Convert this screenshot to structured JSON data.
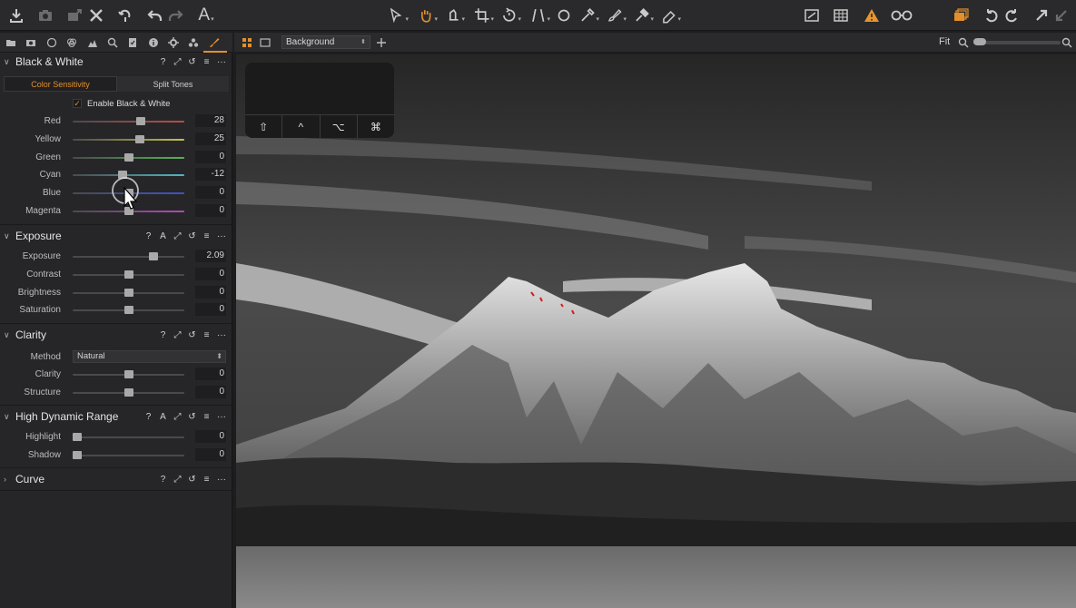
{
  "toolbar": {
    "left_icons": [
      "import-icon",
      "camera-icon",
      "export-icon",
      "delete-icon",
      "undo-history-icon",
      "undo-icon",
      "redo-icon",
      "text-icon"
    ],
    "center_tools": [
      "select-tool-icon",
      "pan-tool-icon",
      "loupe-tool-icon",
      "crop-tool-icon",
      "rotate-tool-icon",
      "keystone-tool-icon",
      "spot-tool-icon",
      "picker-tool-icon",
      "brush-tool-icon",
      "gradient-tool-icon",
      "eraser-tool-icon"
    ],
    "right_icons": [
      "overlay-icon",
      "grid-icon",
      "warning-icon",
      "proof-glasses-icon",
      "stack-icon",
      "rotate-left-icon",
      "rotate-right-icon",
      "expand-icon",
      "collapse-icon"
    ],
    "warning_color": "#e8962e"
  },
  "tool_tabs": {
    "icons": [
      "library-icon",
      "capture-icon",
      "lens-icon",
      "color-icon",
      "exposure-icon",
      "details-icon",
      "adjustments-icon",
      "metadata-icon",
      "output-icon",
      "batch-icon",
      "local-adjust-icon"
    ],
    "active": "local-adjust-icon",
    "accent": "#e28f2c"
  },
  "sections": {
    "bw": {
      "title": "Black & White",
      "actions": [
        "?",
        "⤢",
        "↺",
        "≡",
        "···"
      ],
      "tabs": [
        "Color Sensitivity",
        "Split Tones"
      ],
      "active_tab": "Color Sensitivity",
      "enable_label": "Enable Black & White",
      "enable_checked": true,
      "sliders": [
        {
          "label": "Red",
          "value": "28",
          "fraction": 0.62,
          "color": "#c04a4a"
        },
        {
          "label": "Yellow",
          "value": "25",
          "fraction": 0.61,
          "color": "#c7c14a"
        },
        {
          "label": "Green",
          "value": "0",
          "fraction": 0.5,
          "color": "#56b356"
        },
        {
          "label": "Cyan",
          "value": "-12",
          "fraction": 0.44,
          "color": "#52b6c3"
        },
        {
          "label": "Blue",
          "value": "0",
          "fraction": 0.5,
          "color": "#3f52c6"
        },
        {
          "label": "Magenta",
          "value": "0",
          "fraction": 0.5,
          "color": "#b04ab8"
        }
      ]
    },
    "exposure": {
      "title": "Exposure",
      "actions": [
        "?",
        "A",
        "⤢",
        "↺",
        "≡",
        "···"
      ],
      "sliders": [
        {
          "label": "Exposure",
          "value": "2.09",
          "fraction": 0.74
        },
        {
          "label": "Contrast",
          "value": "0",
          "fraction": 0.5
        },
        {
          "label": "Brightness",
          "value": "0",
          "fraction": 0.5
        },
        {
          "label": "Saturation",
          "value": "0",
          "fraction": 0.5
        }
      ]
    },
    "clarity": {
      "title": "Clarity",
      "actions": [
        "?",
        "⤢",
        "↺",
        "≡",
        "···"
      ],
      "method_label": "Method",
      "method_value": "Natural",
      "sliders": [
        {
          "label": "Clarity",
          "value": "0",
          "fraction": 0.5
        },
        {
          "label": "Structure",
          "value": "0",
          "fraction": 0.5
        }
      ]
    },
    "hdr": {
      "title": "High Dynamic Range",
      "actions": [
        "?",
        "A",
        "⤢",
        "↺",
        "≡",
        "···"
      ],
      "sliders": [
        {
          "label": "Highlight",
          "value": "0",
          "fraction": 0.0
        },
        {
          "label": "Shadow",
          "value": "0",
          "fraction": 0.0
        }
      ]
    },
    "curve": {
      "title": "Curve",
      "actions": [
        "?",
        "⤢",
        "↺",
        "≡",
        "···"
      ]
    }
  },
  "viewer": {
    "layer_select": "Background",
    "zoom_label": "Fit",
    "keypad_keys": [
      "⇧",
      "^",
      "⌥",
      "⌘"
    ]
  }
}
